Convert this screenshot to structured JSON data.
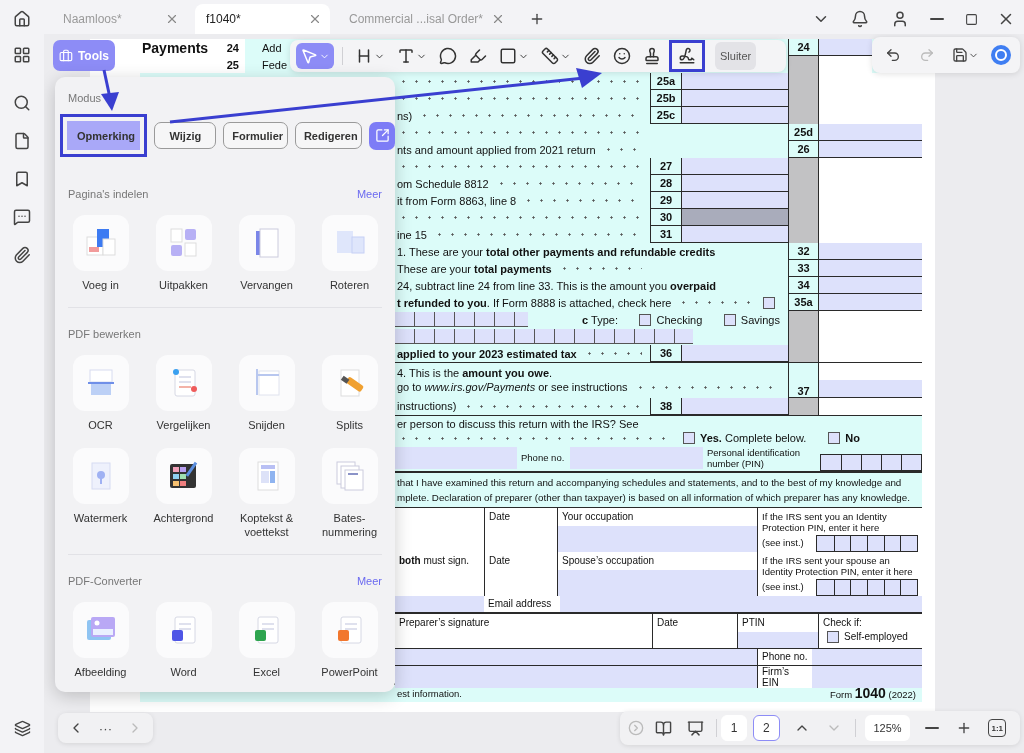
{
  "tabs": [
    {
      "label": "Naamloos*",
      "selected": false
    },
    {
      "label": "f1040*",
      "selected": true
    },
    {
      "label": "Commercial ...isal Order*",
      "selected": false
    }
  ],
  "tools_button": {
    "label": "Tools"
  },
  "toolbar": {
    "tools": [
      {
        "selected": true,
        "menu": true,
        "highlighted": false
      },
      {
        "selected": false,
        "menu": true,
        "highlighted": false
      },
      {
        "selected": false,
        "menu": true,
        "highlighted": false
      },
      {
        "selected": false,
        "menu": false,
        "highlighted": false
      },
      {
        "selected": false,
        "menu": false,
        "highlighted": false
      },
      {
        "selected": false,
        "menu": true,
        "highlighted": false
      },
      {
        "selected": false,
        "menu": true,
        "highlighted": false
      },
      {
        "selected": false,
        "menu": false,
        "highlighted": false
      },
      {
        "selected": false,
        "menu": false,
        "highlighted": false
      },
      {
        "selected": false,
        "menu": false,
        "highlighted": false
      },
      {
        "selected": false,
        "menu": false,
        "highlighted": true
      }
    ],
    "close_label": "Sluiter"
  },
  "tools_panel": {
    "mode_label": "Modus",
    "modes": [
      {
        "label": "Opmerking",
        "selected": true,
        "highlighted": true
      },
      {
        "label": "Wijzig",
        "selected": false,
        "highlighted": false
      },
      {
        "label": "Formulier",
        "selected": false,
        "highlighted": false
      },
      {
        "label": "Redigeren",
        "selected": false,
        "highlighted": false
      }
    ],
    "sections": [
      {
        "title": "Pagina's indelen",
        "more": "Meer",
        "items": [
          {
            "label": "Voeg in"
          },
          {
            "label": "Uitpakken"
          },
          {
            "label": "Vervangen"
          },
          {
            "label": "Roteren"
          }
        ]
      },
      {
        "title": "PDF bewerken",
        "items": [
          {
            "label": "OCR"
          },
          {
            "label": "Vergelijken"
          },
          {
            "label": "Snijden"
          },
          {
            "label": "Splits"
          },
          {
            "label": "Watermerk"
          },
          {
            "label": "Achtergrond"
          },
          {
            "label": "Koptekst & voettekst"
          },
          {
            "label": "Bates-nummering"
          }
        ]
      },
      {
        "title": "PDF-Converter",
        "more": "Meer",
        "items": [
          {
            "label": "Afbeelding"
          },
          {
            "label": "Word"
          },
          {
            "label": "Excel"
          },
          {
            "label": "PowerPoint"
          }
        ]
      }
    ]
  },
  "form": {
    "section": "Payments",
    "lines": [
      {
        "kind": "line",
        "no": "24",
        "text": "Add",
        "outer": "24",
        "shaded": false
      },
      {
        "kind": "line",
        "no": "25",
        "text": "Fede",
        "shaded": false
      },
      {
        "kind": "line",
        "inner": "25a",
        "shaded": false
      },
      {
        "kind": "line",
        "inner": "25b",
        "shaded": false
      },
      {
        "kind": "line",
        "text": "ns)",
        "inner": "25c",
        "shaded": false
      },
      {
        "kind": "line",
        "outer": "25d",
        "shaded": false
      },
      {
        "kind": "line",
        "text": "nts and amount applied from 2021 return",
        "outer": "26",
        "shaded": false
      },
      {
        "kind": "line",
        "inner": "27",
        "shaded": false
      },
      {
        "kind": "line",
        "text": "om Schedule 8812",
        "inner": "28",
        "shaded": false
      },
      {
        "kind": "line",
        "text": "it from Form 8863, line 8",
        "inner": "29",
        "shaded": false
      },
      {
        "kind": "line",
        "inner": "30",
        "shaded": true
      },
      {
        "kind": "line",
        "text": "ine 15",
        "inner": "31",
        "shaded": false
      },
      {
        "kind": "line",
        "text": "1. These are your **total other payments and refundable credits**",
        "outer": "32",
        "shaded": false
      },
      {
        "kind": "line",
        "text": "These are your **total payments**",
        "outer": "33",
        "shaded": false
      },
      {
        "kind": "line",
        "text": "24, subtract line 24 from line 33. This is the amount you **overpaid**",
        "outer": "34",
        "shaded": false
      },
      {
        "kind": "check",
        "text": "**t refunded to you**. If Form 8888 is attached, check here",
        "checked": false,
        "outer": "35a"
      },
      {
        "kind": "type",
        "label": "**c** Type:",
        "options": [
          {
            "label": "Checking",
            "checked": false
          },
          {
            "label": "Savings",
            "checked": false
          }
        ]
      },
      {
        "kind": "account"
      },
      {
        "kind": "line",
        "text": "**applied to your 2023 estimated tax**",
        "inner": "36",
        "shaded": false
      },
      {
        "kind": "double",
        "text": "4. This is the **amount you owe**.",
        "text2": "go to *www.irs.gov/Payments* or see instructions",
        "outer": "37"
      },
      {
        "kind": "line",
        "text": "instructions)",
        "inner": "38",
        "shaded": false
      }
    ],
    "third_party": {
      "question": "er person to discuss this return with the IRS? See",
      "yes": {
        "label": "**Yes.** Complete below.",
        "checked": false
      },
      "no": {
        "label": "No",
        "checked": false
      }
    },
    "designee": {
      "phone_label": "Phone no.",
      "pin_label": "Personal identification number (PIN)"
    },
    "declaration": [
      "that I have examined this return and accompanying schedules and statements, and to the best of my knowledge and",
      "mplete. Declaration of preparer (other than taxpayer) is based on all information of which preparer has any knowledge."
    ],
    "sign": [
      {
        "date": "Date",
        "occupation": "Your occupation",
        "pin_note": "If the IRS sent you an Identity Protection PIN, enter it here",
        "pin_hint": "(see inst.)"
      },
      {
        "note": "**both** must sign.",
        "date": "Date",
        "occupation": "Spouse’s occupation",
        "pin_note": "If the IRS sent your spouse an Identity Protection PIN, enter it here",
        "pin_hint": "(see inst.)"
      }
    ],
    "email": "Email address",
    "preparer": {
      "signature": "Preparer’s signature",
      "date": "Date",
      "ptin": "PTIN",
      "check": "Check if:",
      "self_employed": {
        "label": "Self-employed",
        "checked": false
      },
      "phone": "Phone no.",
      "ein": "Firm’s EIN"
    },
    "footer": {
      "left": "est information.",
      "form": "Form **1040** (2022)"
    }
  },
  "pager": {
    "more": "···",
    "pages": [
      {
        "label": "1",
        "selected": false
      },
      {
        "label": "2",
        "selected": true
      }
    ],
    "zoom": "125%",
    "actual_size": "1:1"
  }
}
